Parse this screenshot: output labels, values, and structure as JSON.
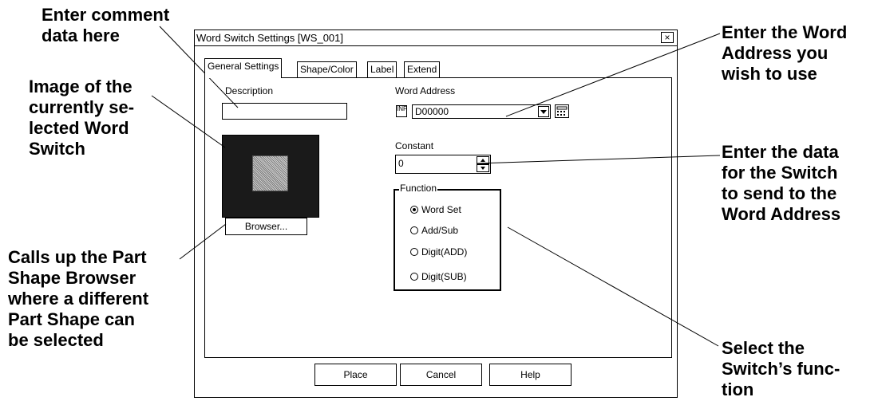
{
  "callouts": {
    "comment": "Enter comment\ndata here",
    "image": "Image of the\ncurrently se-\nlected Word\nSwitch",
    "browser": "Calls up the Part\nShape Browser\nwhere a different\nPart Shape can\nbe selected",
    "word_address": "Enter the Word\nAddress you\nwish to use",
    "constant": "Enter the data\nfor the Switch\nto send to the\nWord Address",
    "function": "Select the\nSwitch’s func-\ntion"
  },
  "dialog": {
    "title": "Word Switch Settings [WS_001]",
    "close_glyph": "×",
    "tabs": [
      {
        "label": "General Settings",
        "active": true
      },
      {
        "label": "Shape/Color",
        "active": false
      },
      {
        "label": "Label",
        "active": false
      },
      {
        "label": "Extend",
        "active": false
      }
    ],
    "description": {
      "label": "Description",
      "value": ""
    },
    "word_address": {
      "label": "Word Address",
      "value": "D00000",
      "icon_text": "INP"
    },
    "constant": {
      "label": "Constant",
      "value": "0"
    },
    "browser_button": "Browser...",
    "function": {
      "label": "Function",
      "options": [
        {
          "label": "Word Set",
          "selected": true
        },
        {
          "label": "Add/Sub",
          "selected": false
        },
        {
          "label": "Digit(ADD)",
          "selected": false
        },
        {
          "label": "Digit(SUB)",
          "selected": false
        }
      ]
    },
    "buttons": {
      "place": "Place",
      "cancel": "Cancel",
      "help": "Help"
    }
  },
  "icons": {
    "close": "close-icon",
    "dropdown": "chevron-down-icon",
    "keypad": "keypad-icon",
    "input": "input-icon",
    "spin_up": "spin-up-icon",
    "spin_down": "spin-down-icon",
    "radio": "radio-icon"
  }
}
